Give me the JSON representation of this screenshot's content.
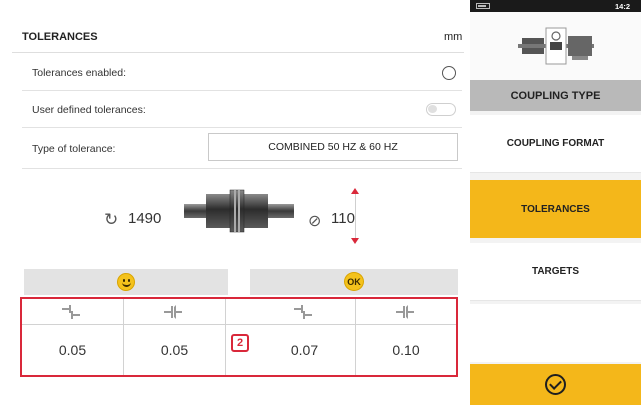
{
  "header": {
    "title": "TOLERANCES",
    "unit": "mm"
  },
  "settings": {
    "tolerances_enabled_label": "Tolerances enabled:",
    "user_defined_label": "User defined tolerances:",
    "type_label": "Type of tolerance:",
    "type_value": "COMBINED 50 HZ & 60 HZ"
  },
  "machine": {
    "rpm": "1490",
    "coupling_diameter": "110"
  },
  "tolerance_table": {
    "status_left": "smiley",
    "status_right": "OK",
    "callout": "2",
    "values": [
      "0.05",
      "0.05",
      "0.07",
      "0.10"
    ]
  },
  "status_bar": {
    "time": "14:2"
  },
  "nav": {
    "coupling_type": "COUPLING TYPE",
    "items": [
      {
        "label": "COUPLING FORMAT",
        "active": false
      },
      {
        "label": "TOLERANCES",
        "active": true
      },
      {
        "label": "TARGETS",
        "active": false
      }
    ]
  },
  "colors": {
    "accent": "#f4b71a",
    "highlight": "#d9283a",
    "inactive_bar": "#e3e3e3"
  },
  "icons": [
    "rotation-icon",
    "diameter-icon",
    "confirm-check-icon",
    "smiley-icon",
    "offset-icon",
    "angularity-icon"
  ]
}
